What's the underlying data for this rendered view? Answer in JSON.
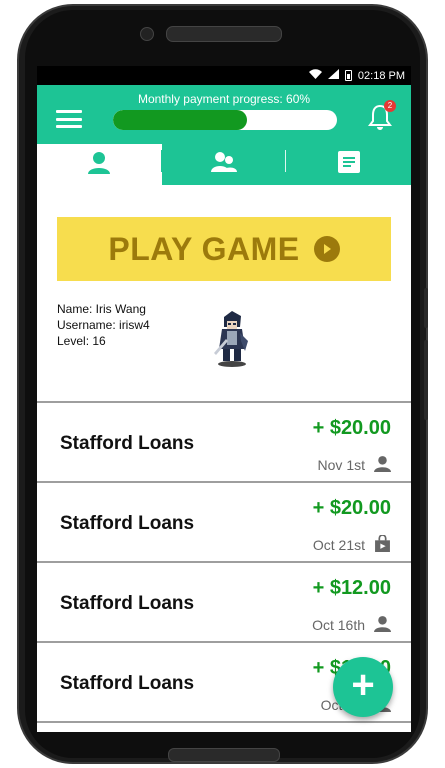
{
  "status": {
    "time": "02:18 PM"
  },
  "header": {
    "progress_label": "Monthly payment progress: 60%",
    "progress_value": 0.6,
    "notification_count": "2"
  },
  "tabs": [
    {
      "icon": "person-icon",
      "active": true
    },
    {
      "icon": "group-icon",
      "active": false
    },
    {
      "icon": "list-icon",
      "active": false
    }
  ],
  "play": {
    "label": "PLAY GAME"
  },
  "player": {
    "name_line": "Name: Iris Wang",
    "username_line": "Username: irisw4",
    "level_line": "Level: 16"
  },
  "transactions": [
    {
      "title": "Stafford Loans",
      "amount": "+ $20.00",
      "date": "Nov 1st",
      "icon": "person-icon"
    },
    {
      "title": "Stafford Loans",
      "amount": "+ $20.00",
      "date": "Oct 21st",
      "icon": "shopping-bag-icon"
    },
    {
      "title": "Stafford Loans",
      "amount": "+ $12.00",
      "date": "Oct 16th",
      "icon": "person-icon"
    },
    {
      "title": "Stafford Loans",
      "amount": "+ $12.00",
      "date": "Oct 1st",
      "icon": "person-icon"
    }
  ],
  "colors": {
    "primary": "#1dc495",
    "accent_green": "#129920",
    "play_bg": "#f7dd4e",
    "play_text": "#9c7a0c"
  }
}
